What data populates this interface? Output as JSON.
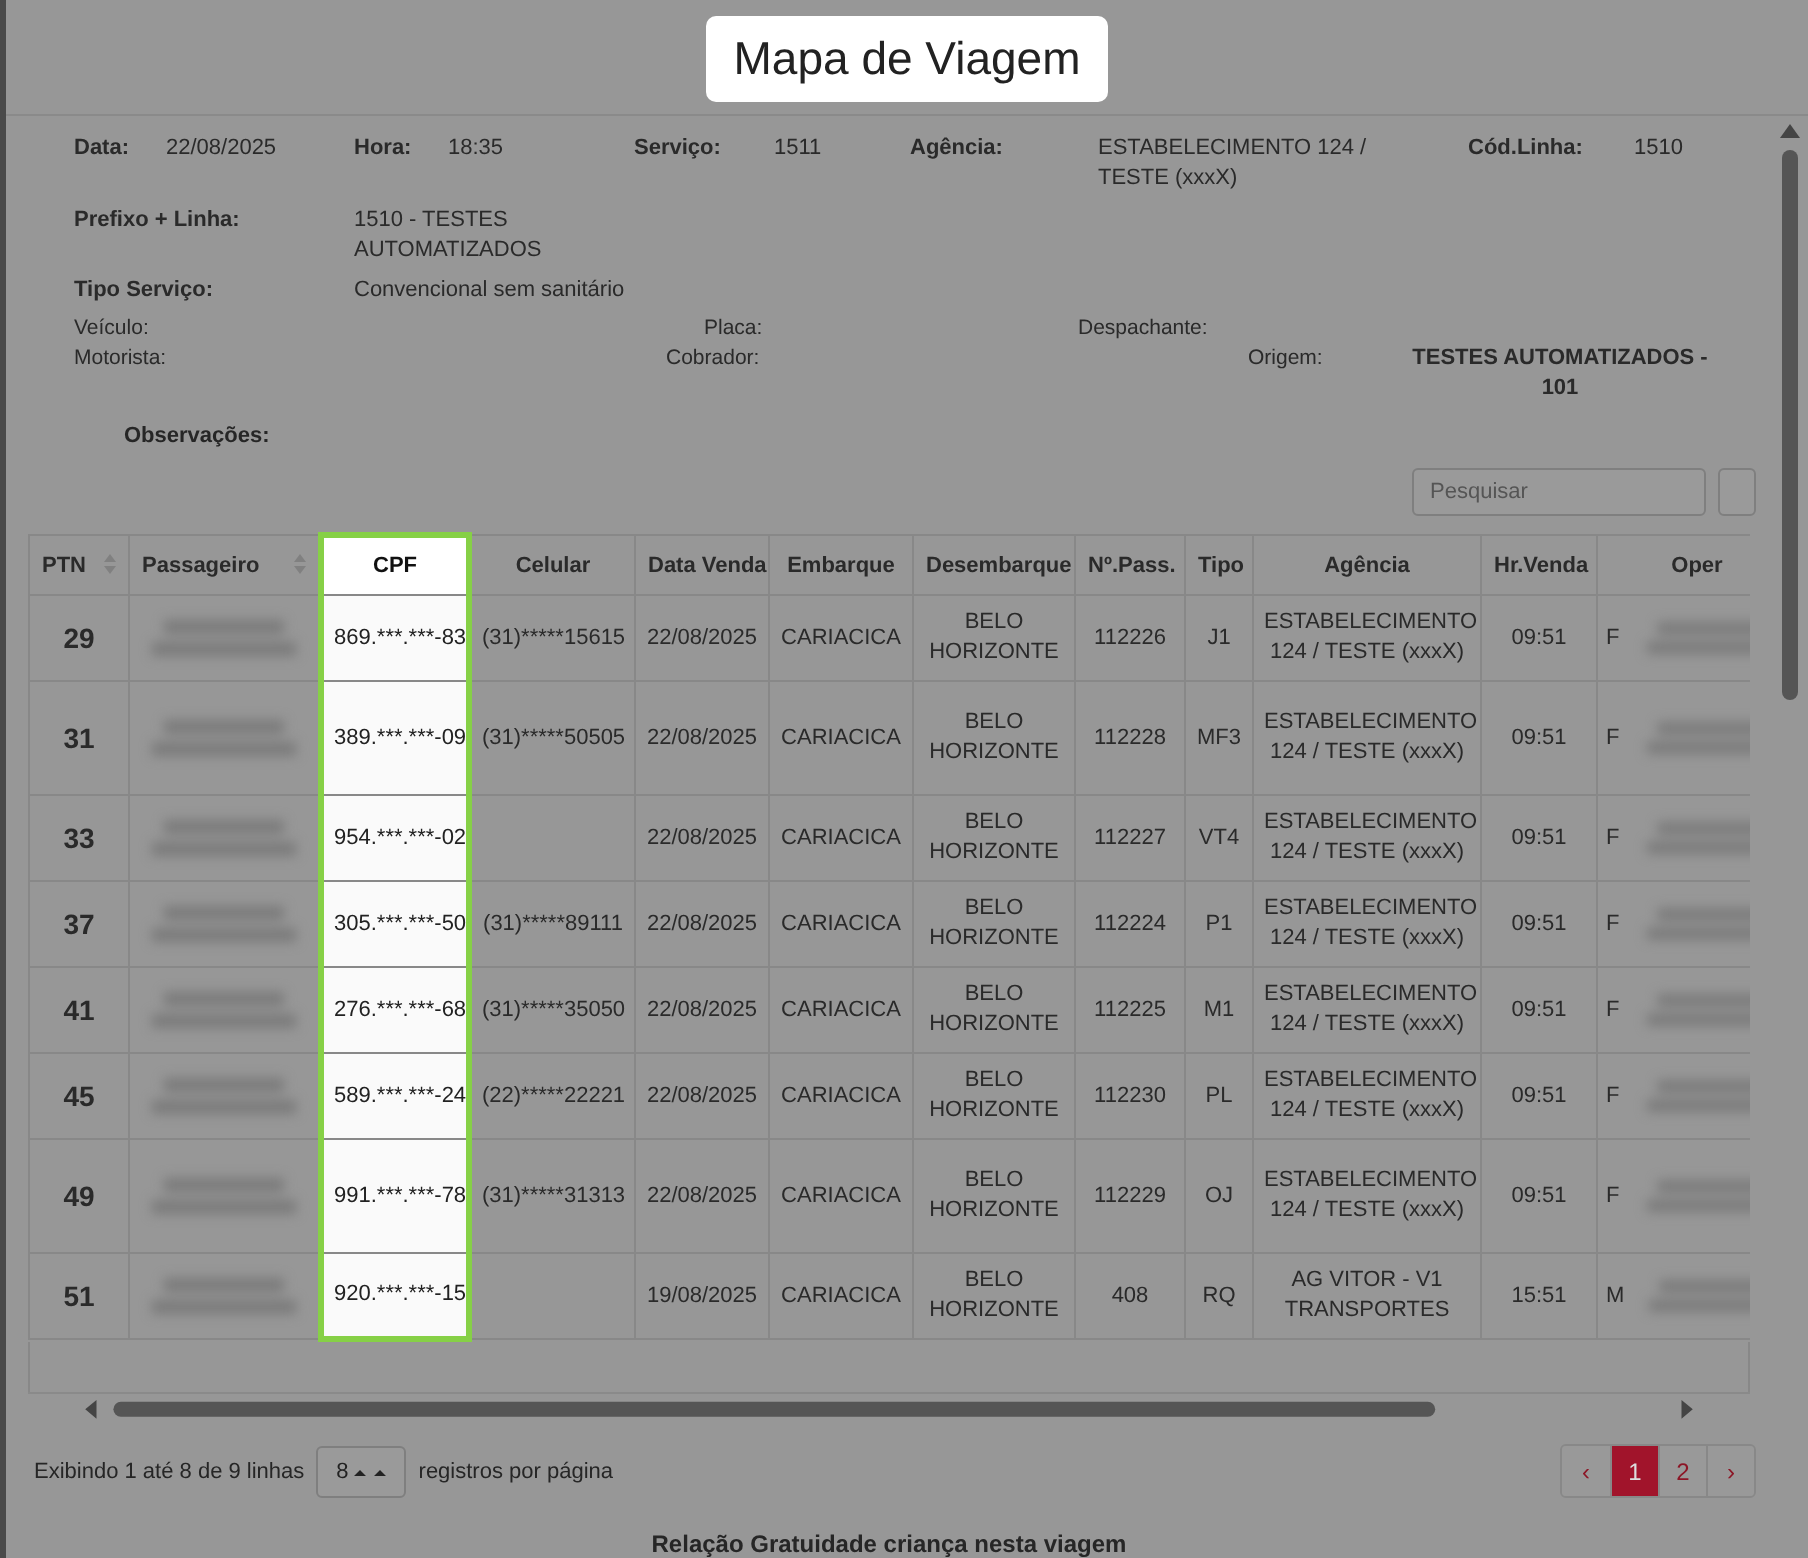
{
  "title": "Mapa de Viagem",
  "header": {
    "row1": [
      {
        "label": "Data:",
        "value": "22/08/2025"
      },
      {
        "label": "Hora:",
        "value": "18:35"
      },
      {
        "label": "Serviço:",
        "value": "1511"
      },
      {
        "label": "Agência:",
        "value": "ESTABELECIMENTO 124 / TESTE (xxxX)"
      },
      {
        "label": "Cód.Linha:",
        "value": "1510"
      }
    ],
    "row2": [
      {
        "label": "Prefixo + Linha:",
        "value": "1510 - TESTES AUTOMATIZADOS"
      }
    ],
    "row3": [
      {
        "label": "Tipo Serviço:",
        "value": "Convencional sem sanitário"
      }
    ],
    "row4": [
      {
        "label": "Veículo:"
      },
      {
        "label": "Placa:"
      },
      {
        "label": "Despachante:"
      }
    ],
    "row5": [
      {
        "label": "Motorista:"
      },
      {
        "label": "Cobrador:"
      },
      {
        "label": "Origem:",
        "value": "TESTES AUTOMATIZADOS - 101"
      }
    ],
    "observacoes": {
      "label": "Observações:"
    }
  },
  "search": {
    "placeholder": "Pesquisar"
  },
  "table": {
    "columns": [
      {
        "label": "PTN",
        "sortable": true,
        "highlighted": false
      },
      {
        "label": "Passageiro",
        "sortable": true,
        "highlighted": false
      },
      {
        "label": "CPF",
        "sortable": false,
        "highlighted": true
      },
      {
        "label": "Celular",
        "sortable": false,
        "highlighted": false
      },
      {
        "label": "Data Venda",
        "sortable": false,
        "highlighted": false
      },
      {
        "label": "Embarque",
        "sortable": false,
        "highlighted": false
      },
      {
        "label": "Desembarque",
        "sortable": false,
        "highlighted": false
      },
      {
        "label": "Nº.Pass.",
        "sortable": false,
        "highlighted": false
      },
      {
        "label": "Tipo",
        "sortable": false,
        "highlighted": false
      },
      {
        "label": "Agência",
        "sortable": false,
        "highlighted": false
      },
      {
        "label": "Hr.Venda",
        "sortable": false,
        "highlighted": false
      },
      {
        "label": "Oper",
        "sortable": false,
        "highlighted": false
      }
    ],
    "rows": [
      {
        "ptn": "29",
        "cpf": "869.***.***-83",
        "celular": "(31)*****15615",
        "data_venda": "22/08/2025",
        "embarque": "CARIACICA",
        "desembarque": "BELO HORIZONTE",
        "n_pass": "112226",
        "tipo": "J1",
        "agencia": "ESTABELECIMENTO 124 / TESTE (xxxX)",
        "hr_venda": "09:51",
        "oper": "F",
        "tall": false
      },
      {
        "ptn": "31",
        "cpf": "389.***.***-09",
        "celular": "(31)*****50505",
        "data_venda": "22/08/2025",
        "embarque": "CARIACICA",
        "desembarque": "BELO HORIZONTE",
        "n_pass": "112228",
        "tipo": "MF3",
        "agencia": "ESTABELECIMENTO 124 / TESTE (xxxX)",
        "hr_venda": "09:51",
        "oper": "F",
        "tall": true
      },
      {
        "ptn": "33",
        "cpf": "954.***.***-02",
        "data_venda": "22/08/2025",
        "embarque": "CARIACICA",
        "desembarque": "BELO HORIZONTE",
        "n_pass": "112227",
        "tipo": "VT4",
        "agencia": "ESTABELECIMENTO 124 / TESTE (xxxX)",
        "hr_venda": "09:51",
        "oper": "F",
        "tall": false
      },
      {
        "ptn": "37",
        "cpf": "305.***.***-50",
        "celular": "(31)*****89111",
        "data_venda": "22/08/2025",
        "embarque": "CARIACICA",
        "desembarque": "BELO HORIZONTE",
        "n_pass": "112224",
        "tipo": "P1",
        "agencia": "ESTABELECIMENTO 124 / TESTE (xxxX)",
        "hr_venda": "09:51",
        "oper": "F",
        "tall": false
      },
      {
        "ptn": "41",
        "cpf": "276.***.***-68",
        "celular": "(31)*****35050",
        "data_venda": "22/08/2025",
        "embarque": "CARIACICA",
        "desembarque": "BELO HORIZONTE",
        "n_pass": "112225",
        "tipo": "M1",
        "agencia": "ESTABELECIMENTO 124 / TESTE (xxxX)",
        "hr_venda": "09:51",
        "oper": "F",
        "tall": false
      },
      {
        "ptn": "45",
        "cpf": "589.***.***-24",
        "celular": "(22)*****22221",
        "data_venda": "22/08/2025",
        "embarque": "CARIACICA",
        "desembarque": "BELO HORIZONTE",
        "n_pass": "112230",
        "tipo": "PL",
        "agencia": "ESTABELECIMENTO 124 / TESTE (xxxX)",
        "hr_venda": "09:51",
        "oper": "F",
        "tall": false
      },
      {
        "ptn": "49",
        "cpf": "991.***.***-78",
        "celular": "(31)*****31313",
        "data_venda": "22/08/2025",
        "embarque": "CARIACICA",
        "desembarque": "BELO HORIZONTE",
        "n_pass": "112229",
        "tipo": "OJ",
        "agencia": "ESTABELECIMENTO 124 / TESTE (xxxX)",
        "hr_venda": "09:51",
        "oper": "F",
        "tall": true
      },
      {
        "ptn": "51",
        "cpf": "920.***.***-15",
        "data_venda": "19/08/2025",
        "embarque": "CARIACICA",
        "desembarque": "BELO HORIZONTE",
        "n_pass": "408",
        "tipo": "RQ",
        "agencia": "AG VITOR - V1 TRANSPORTES",
        "hr_venda": "15:51",
        "oper": "M",
        "tall": false
      }
    ]
  },
  "footer": {
    "info": "Exibindo 1 até 8 de 9 linhas",
    "page_size": "8",
    "page_size_label": "registros por página",
    "pages": [
      {
        "label": "‹",
        "selected": false
      },
      {
        "label": "1",
        "selected": true
      },
      {
        "label": "2",
        "selected": false
      },
      {
        "label": "›",
        "selected": false
      }
    ]
  },
  "section_title": "Relação Gratuidade criança nesta viagem"
}
